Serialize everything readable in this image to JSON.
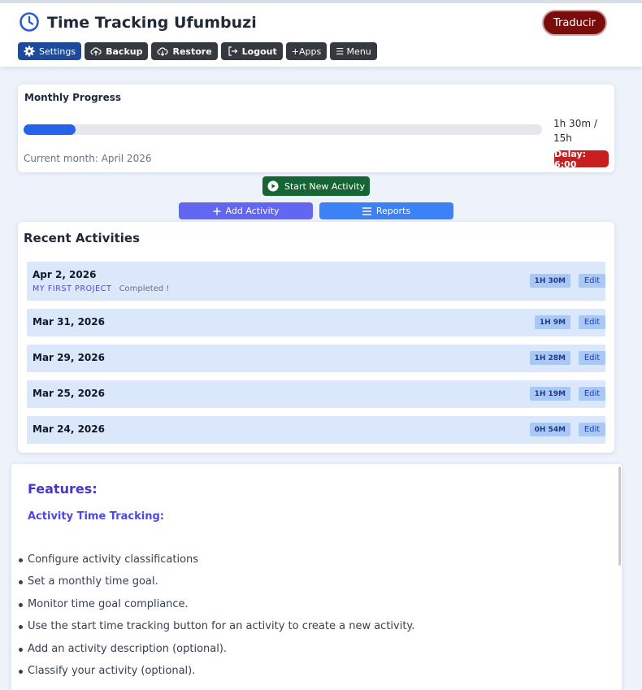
{
  "header": {
    "title": "Time Tracking Ufumbuzi",
    "translate_label": "Traducir",
    "toolbar": {
      "settings": "Settings",
      "backup": "Backup",
      "restore": "Restore",
      "logout": "Logout",
      "apps": "+Apps",
      "menu": "☰ Menu"
    }
  },
  "progress": {
    "title": "Monthly Progress",
    "fraction": 0.1,
    "amount": "1h 30m / 15h",
    "month_label": "Current month: April 2026",
    "delay": "Delay: 6:00"
  },
  "actions": {
    "start": "Start New Activity",
    "add": "Add Activity",
    "reports": "Reports"
  },
  "recent": {
    "title": "Recent Activities",
    "edit_label": "Edit",
    "items": [
      {
        "date": "Apr 2, 2026",
        "project": "MY FIRST PROJECT",
        "note": "Completed !",
        "duration": "1H 30M"
      },
      {
        "date": "Mar 31, 2026",
        "duration": "1H 9M"
      },
      {
        "date": "Mar 29, 2026",
        "duration": "1H 28M"
      },
      {
        "date": "Mar 25, 2026",
        "duration": "1H 19M"
      },
      {
        "date": "Mar 24, 2026",
        "duration": "0H 54M"
      }
    ]
  },
  "features": {
    "title": "Features:",
    "subtitle": "Activity Time Tracking:",
    "items": [
      "Configure activity classifications",
      "Set a monthly time goal.",
      "Monitor time goal compliance.",
      "Use the start time tracking button for an activity to create a new activity.",
      "Add an activity description (optional).",
      "Classify your activity (optional)."
    ]
  },
  "colors": {
    "accent": "#2563eb",
    "delay": "#c81e1e",
    "start": "#166534",
    "add": "#6366f1",
    "reports": "#3b82f6"
  }
}
